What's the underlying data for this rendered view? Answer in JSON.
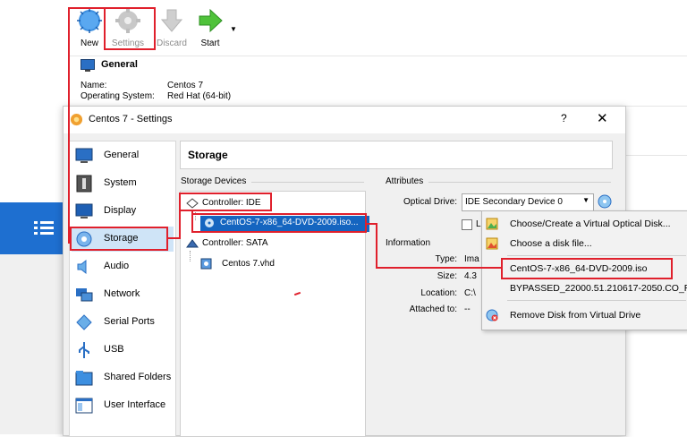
{
  "toolbar": {
    "new_label": "New",
    "settings_label": "Settings",
    "discard_label": "Discard",
    "start_label": "Start"
  },
  "details": {
    "section_title": "General",
    "name_label": "Name:",
    "name_value": "Centos 7",
    "os_label": "Operating System:",
    "os_value": "Red Hat (64-bit)"
  },
  "dialog": {
    "title": "Centos 7 - Settings",
    "help": "?",
    "close": "✕",
    "header": "Storage",
    "categories": [
      {
        "label": "General",
        "icon": "general-icon"
      },
      {
        "label": "System",
        "icon": "system-icon"
      },
      {
        "label": "Display",
        "icon": "display-icon"
      },
      {
        "label": "Storage",
        "icon": "storage-icon"
      },
      {
        "label": "Audio",
        "icon": "audio-icon"
      },
      {
        "label": "Network",
        "icon": "network-icon"
      },
      {
        "label": "Serial Ports",
        "icon": "serial-ports-icon"
      },
      {
        "label": "USB",
        "icon": "usb-icon"
      },
      {
        "label": "Shared Folders",
        "icon": "shared-folders-icon"
      },
      {
        "label": "User Interface",
        "icon": "user-interface-icon"
      }
    ],
    "selected_category": "Storage",
    "storage_devices_label": "Storage Devices",
    "tree": {
      "controller_ide": "Controller: IDE",
      "ide_disk": "CentOS-7-x86_64-DVD-2009.iso...",
      "controller_sata": "Controller: SATA",
      "sata_disk": "Centos 7.vhd"
    },
    "attributes_label": "Attributes",
    "optical_drive_label": "Optical Drive:",
    "optical_drive_value": "IDE Secondary Device 0",
    "live_cd_partial": "L",
    "information_label": "Information",
    "info": {
      "type_label": "Type:",
      "type_value": "Ima",
      "size_label": "Size:",
      "size_value": "4.3",
      "location_label": "Location:",
      "location_value": "C:\\",
      "attached_label": "Attached to:",
      "attached_value": "--"
    }
  },
  "menu": {
    "items": [
      "Choose/Create a Virtual Optical Disk...",
      "Choose a disk file...",
      "CentOS-7-x86_64-DVD-2009.iso",
      "BYPASSED_22000.51.210617-2050.CO_R",
      "Remove Disk from Virtual Drive"
    ]
  },
  "colors": {
    "accent": "#1565c0",
    "annotation": "#e0202c",
    "selection": "#cfe4f7"
  }
}
